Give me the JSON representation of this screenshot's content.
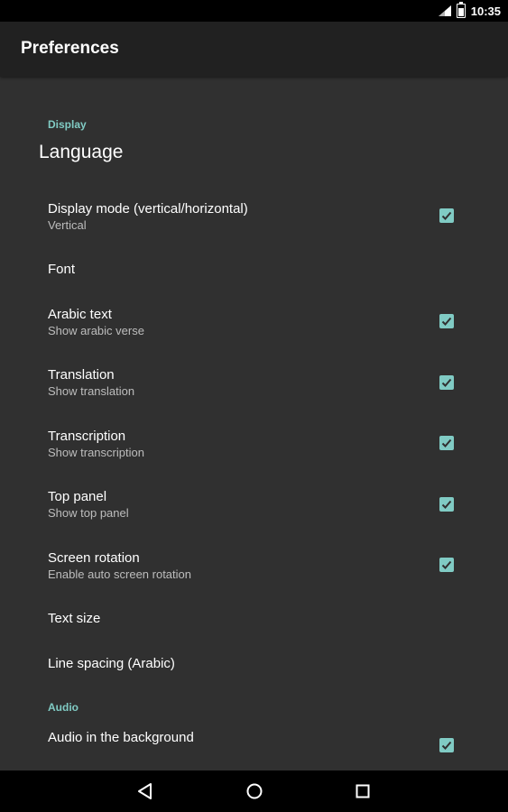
{
  "status_bar": {
    "time": "10:35"
  },
  "app_bar": {
    "title": "Preferences"
  },
  "sections": {
    "display": {
      "header": "Display",
      "language_label": "Language"
    },
    "audio": {
      "header": "Audio"
    }
  },
  "prefs": {
    "display_mode": {
      "title": "Display mode (vertical/horizontal)",
      "summary": "Vertical",
      "checked": true
    },
    "font": {
      "title": "Font"
    },
    "arabic_text": {
      "title": "Arabic text",
      "summary": "Show arabic verse",
      "checked": true
    },
    "translation": {
      "title": "Translation",
      "summary": "Show translation",
      "checked": true
    },
    "transcription": {
      "title": "Transcription",
      "summary": "Show transcription",
      "checked": true
    },
    "top_panel": {
      "title": "Top panel",
      "summary": "Show top panel",
      "checked": true
    },
    "screen_rotation": {
      "title": "Screen rotation",
      "summary": "Enable auto screen rotation",
      "checked": true
    },
    "text_size": {
      "title": "Text size"
    },
    "line_spacing": {
      "title": "Line spacing (Arabic)"
    },
    "audio_background": {
      "title": "Audio in the background",
      "checked": true
    }
  },
  "colors": {
    "accent": "#80cbc4",
    "app_bar": "#212121",
    "background": "#303030"
  },
  "icons": {
    "back": "triangle-back-icon",
    "home": "circle-home-icon",
    "recents": "square-recents-icon",
    "signal": "signal-icon",
    "battery": "battery-icon"
  }
}
